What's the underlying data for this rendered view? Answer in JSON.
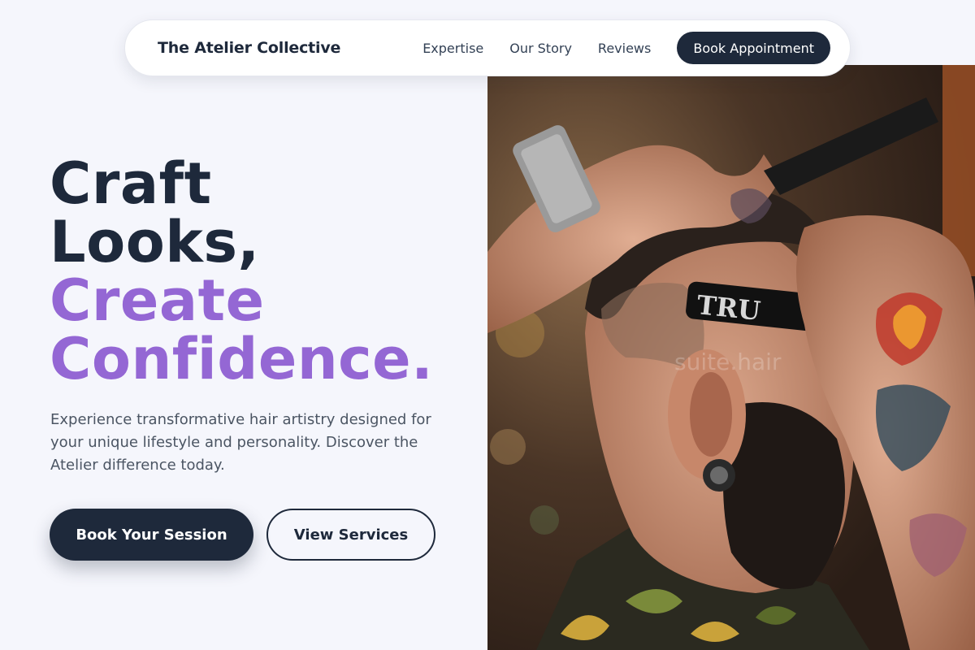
{
  "nav": {
    "brand": "The Atelier Collective",
    "links": [
      "Expertise",
      "Our Story",
      "Reviews"
    ],
    "cta": "Book Appointment"
  },
  "hero": {
    "headline_line1": "Craft",
    "headline_line2": "Looks,",
    "headline_line3": "Create",
    "headline_line4": "Confidence.",
    "subcopy": "Experience transformative hair artistry designed for your unique lifestyle and personality. Discover the Atelier difference today.",
    "primary_button": "Book Your Session",
    "secondary_button": "View Services",
    "image_razor_text": "TRU",
    "image_watermark": "suite.hair"
  },
  "colors": {
    "background": "#f5f6fc",
    "dark": "#1e293b",
    "accent": "#9467d4",
    "body_text": "#4b5563"
  }
}
